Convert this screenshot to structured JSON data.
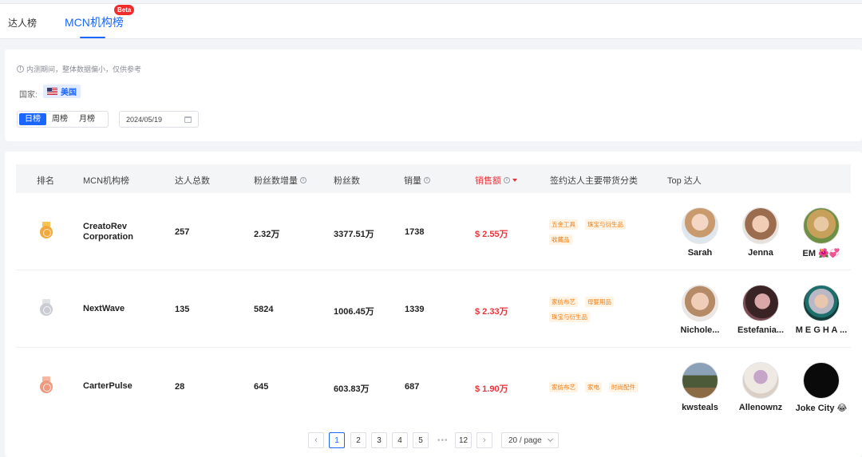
{
  "tabs": [
    {
      "label": "达人榜"
    },
    {
      "label": "MCN机构榜",
      "badge": "Beta"
    }
  ],
  "filters": {
    "notice": "内测期间，整体数据偏小，仅供参考",
    "country_label": "国家:",
    "country": "美国",
    "periods": [
      "日榜",
      "周榜",
      "月榜"
    ],
    "active_period": "日榜",
    "date": "2024/05/19"
  },
  "table": {
    "headers": {
      "rank": "排名",
      "mcn": "MCN机构榜",
      "total_creators": "达人总数",
      "follower_growth": "粉丝数增量",
      "followers": "粉丝数",
      "sales_volume": "销量",
      "revenue": "销售额",
      "categories": "签约达人主要带货分类",
      "top_creators": "Top 达人"
    },
    "rows": [
      {
        "medal": "gold",
        "name": "CreatoRev Corporation",
        "total_creators": "257",
        "follower_growth": "2.32万",
        "followers": "3377.51万",
        "sales_volume": "1738",
        "revenue": "$ 2.55万",
        "categories": [
          "五金工具",
          "珠宝与衍生品",
          "收藏品"
        ],
        "creators": [
          "Sarah",
          "Jenna",
          "EM 🌺💞"
        ]
      },
      {
        "medal": "silver",
        "name": "NextWave",
        "total_creators": "135",
        "follower_growth": "5824",
        "followers": "1006.45万",
        "sales_volume": "1339",
        "revenue": "$ 2.33万",
        "categories": [
          "家纺布艺",
          "母婴用品",
          "珠宝与衍生品"
        ],
        "creators": [
          "Nichole...",
          "Estefania...",
          "M E G H A ..."
        ]
      },
      {
        "medal": "bronze",
        "name": "CarterPulse",
        "total_creators": "28",
        "follower_growth": "645",
        "followers": "603.83万",
        "sales_volume": "687",
        "revenue": "$ 1.90万",
        "categories": [
          "家纺布艺",
          "家电",
          "时尚配件"
        ],
        "creators": [
          "kwsteals",
          "Allenownz",
          "Joke City 😂"
        ]
      }
    ]
  },
  "pagination": {
    "pages": [
      "1",
      "2",
      "3",
      "4",
      "5"
    ],
    "dots": "•••",
    "last": "12",
    "active": "1",
    "page_size": "20 / page",
    "prev": "‹",
    "next": "›"
  },
  "colors": {
    "accent": "#1a66ff",
    "revenue": "#e8333a",
    "tag_text": "#f07b10",
    "tag_bg": "#fff3e4"
  }
}
